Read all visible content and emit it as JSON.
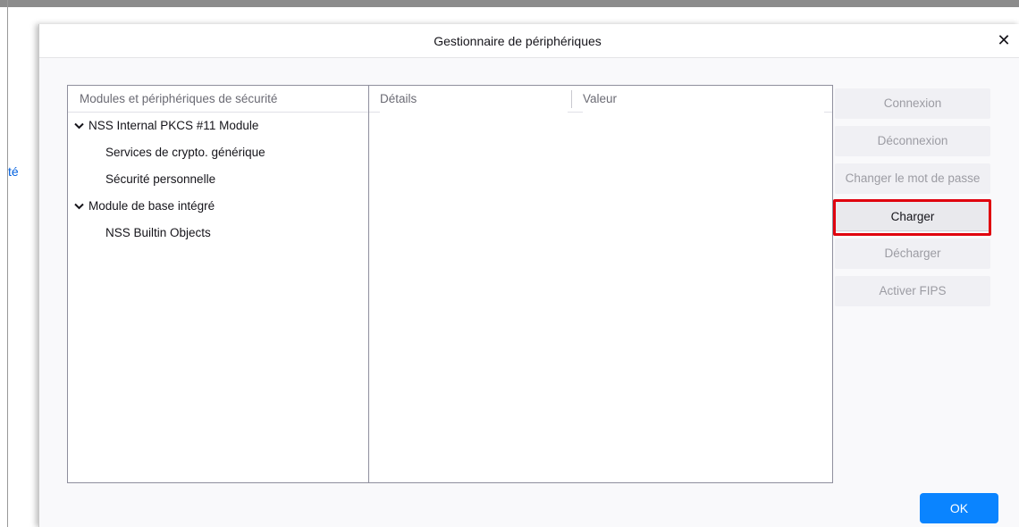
{
  "background": {
    "fragment_text": "té"
  },
  "dialog": {
    "title": "Gestionnaire de périphériques",
    "close_glyph": "✕"
  },
  "tree": {
    "header": "Modules et périphériques de sécurité",
    "rows": [
      {
        "label": "NSS Internal PKCS #11 Module",
        "level": 0,
        "expanded": true
      },
      {
        "label": "Services de crypto. générique",
        "level": 1
      },
      {
        "label": "Sécurité personnelle",
        "level": 1
      },
      {
        "label": "Module de base intégré",
        "level": 0,
        "expanded": true
      },
      {
        "label": "NSS Builtin Objects",
        "level": 1
      }
    ]
  },
  "details": {
    "col_details": "Détails",
    "col_value": "Valeur"
  },
  "buttons": {
    "connexion": {
      "label": "Connexion",
      "enabled": false
    },
    "deconnexion": {
      "label": "Déconnexion",
      "enabled": false
    },
    "change_password": {
      "label": "Changer le mot de passe",
      "enabled": false
    },
    "charger": {
      "label": "Charger",
      "enabled": true,
      "highlighted": true
    },
    "decharger": {
      "label": "Décharger",
      "enabled": false
    },
    "fips": {
      "label": "Activer FIPS",
      "enabled": false
    },
    "ok": {
      "label": "OK"
    }
  },
  "colors": {
    "accent": "#0a84ff",
    "highlight": "#e0000e",
    "disabled_text": "#9c9ca3"
  }
}
